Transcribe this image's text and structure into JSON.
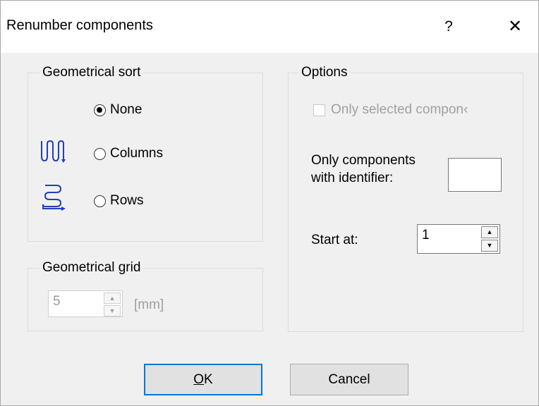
{
  "dialog": {
    "title": "Renumber components",
    "help_label": "?",
    "close_label": "✕"
  },
  "geometrical_sort": {
    "legend": "Geometrical sort",
    "options": [
      {
        "label": "None",
        "checked": true
      },
      {
        "label": "Columns",
        "checked": false
      },
      {
        "label": "Rows",
        "checked": false
      }
    ]
  },
  "geometrical_grid": {
    "legend": "Geometrical grid",
    "value": "5",
    "unit": "[mm]"
  },
  "options": {
    "legend": "Options",
    "only_selected_label": "Only selected compon‹",
    "identifier_label_line1": "Only components",
    "identifier_label_line2": "with identifier:",
    "identifier_value": "",
    "start_at_label": "Start at:",
    "start_at_value": "1"
  },
  "buttons": {
    "ok_rest": "K",
    "ok_accel": "O",
    "cancel": "Cancel"
  },
  "colors": {
    "accent": "#0078d7",
    "icon_blue": "#1f3fbf"
  }
}
